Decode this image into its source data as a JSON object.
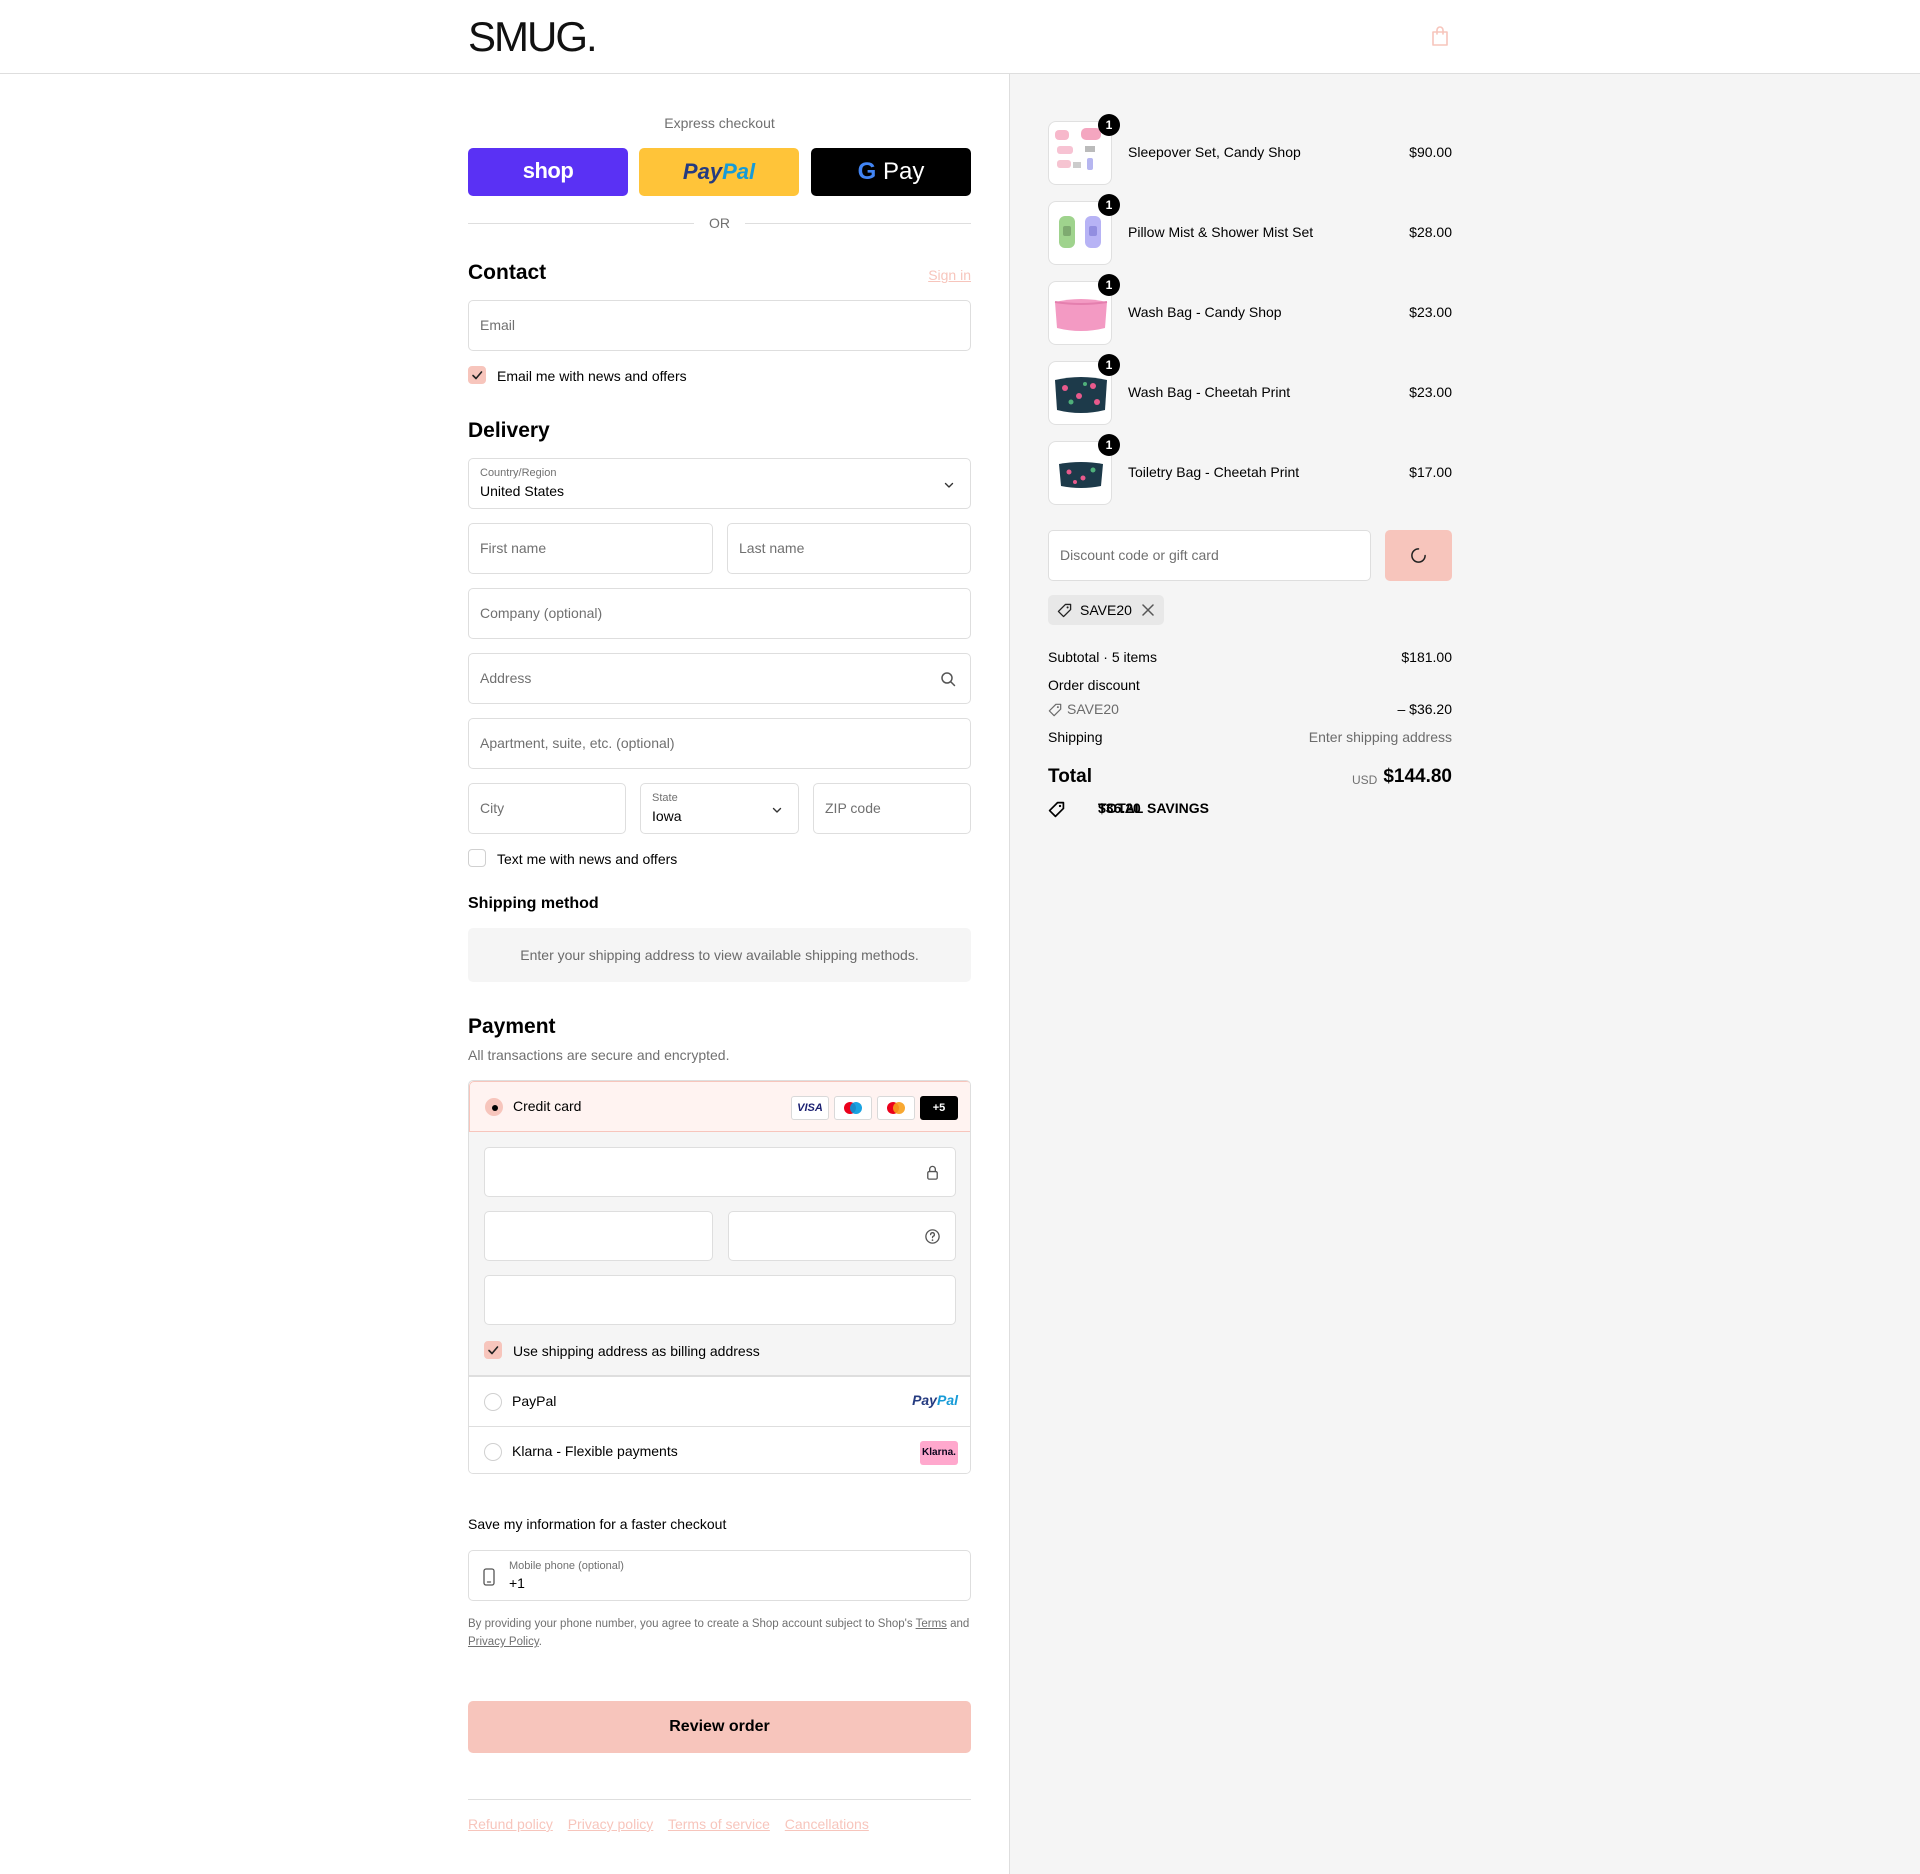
{
  "brand": {
    "logo_text": "SMUG",
    "logo_dot": "."
  },
  "header": {
    "cart_icon": "shopping-bag-icon"
  },
  "express": {
    "title": "Express checkout",
    "shop_label": "shop",
    "paypal_label_1": "Pay",
    "paypal_label_2": "Pal",
    "gpay_g": "G",
    "gpay_label": " Pay",
    "or_text": "OR"
  },
  "contact": {
    "title": "Contact",
    "sign_in": "Sign in",
    "email_placeholder": "Email",
    "newsletter_label": "Email me with news and offers",
    "newsletter_checked": true
  },
  "delivery": {
    "title": "Delivery",
    "country_label": "Country/Region",
    "country_value": "United States",
    "first_name_placeholder": "First name",
    "last_name_placeholder": "Last name",
    "company_placeholder": "Company (optional)",
    "address_placeholder": "Address",
    "apartment_placeholder": "Apartment, suite, etc. (optional)",
    "city_placeholder": "City",
    "state_label": "State",
    "state_value": "Iowa",
    "zip_placeholder": "ZIP code",
    "sms_label": "Text me with news and offers",
    "sms_checked": false
  },
  "shipping_method": {
    "title": "Shipping method",
    "note": "Enter your shipping address to view available shipping methods."
  },
  "payment": {
    "title": "Payment",
    "subtitle": "All transactions are secure and encrypted.",
    "credit_card_label": "Credit card",
    "card_logos": [
      "VISA",
      "maestro",
      "mastercard",
      "+5"
    ],
    "billing_same_label": "Use shipping address as billing address",
    "billing_same_checked": true,
    "paypal_label": "PayPal",
    "paypal_logo_1": "Pay",
    "paypal_logo_2": "Pal",
    "klarna_label": "Klarna - Flexible payments",
    "klarna_logo": "Klarna."
  },
  "save_info": {
    "title": "Save my information for a faster checkout",
    "phone_label": "Mobile phone (optional)",
    "phone_value": "+1",
    "legal_1": "By providing your phone number, you agree to create a Shop account subject to Shop's ",
    "legal_terms": "Terms",
    "legal_2": " and ",
    "legal_privacy": "Privacy Policy",
    "legal_3": "."
  },
  "review_button": "Review order",
  "footer_links": [
    "Refund policy",
    "Privacy policy",
    "Terms of service",
    "Cancellations"
  ],
  "order": {
    "items": [
      {
        "name": "Sleepover Set, Candy Shop",
        "price": "$90.00",
        "qty": "1"
      },
      {
        "name": "Pillow Mist & Shower Mist Set",
        "price": "$28.00",
        "qty": "1"
      },
      {
        "name": "Wash Bag - Candy Shop",
        "price": "$23.00",
        "qty": "1"
      },
      {
        "name": "Wash Bag - Cheetah Print",
        "price": "$23.00",
        "qty": "1"
      },
      {
        "name": "Toiletry Bag - Cheetah Print",
        "price": "$17.00",
        "qty": "1"
      }
    ],
    "discount_placeholder": "Discount code or gift card",
    "applied_code": "SAVE20",
    "subtotal_label": "Subtotal · 5 items",
    "subtotal_value": "$181.00",
    "order_discount_label": "Order discount",
    "discount_code": "SAVE20",
    "discount_value": "– $36.20",
    "shipping_label": "Shipping",
    "shipping_value": "Enter shipping address",
    "total_label": "Total",
    "total_currency": "USD",
    "total_value": "$144.80",
    "savings_label": "TOTAL SAVINGS",
    "savings_value": "$36.20"
  },
  "colors": {
    "accent": "#f7c5bc",
    "shop_pay": "#5a31f4",
    "paypal_yellow": "#ffc439",
    "summary_bg": "#f5f5f5"
  }
}
